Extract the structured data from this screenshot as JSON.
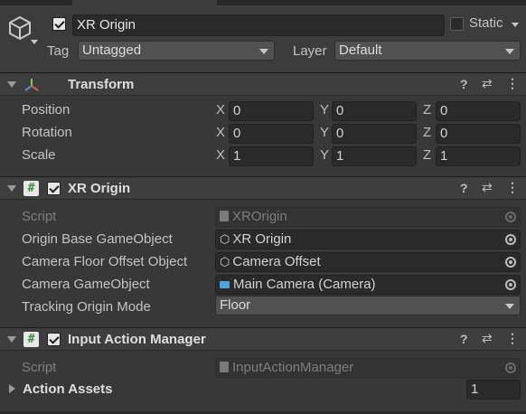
{
  "gameobject": {
    "name": "XR Origin",
    "active": true,
    "static_label": "Static",
    "static_checked": false,
    "tag_label": "Tag",
    "tag_value": "Untagged",
    "layer_label": "Layer",
    "layer_value": "Default"
  },
  "transform": {
    "title": "Transform",
    "rows": [
      {
        "label": "Position",
        "x": "0",
        "y": "0",
        "z": "0"
      },
      {
        "label": "Rotation",
        "x": "0",
        "y": "0",
        "z": "0"
      },
      {
        "label": "Scale",
        "x": "1",
        "y": "1",
        "z": "1"
      }
    ],
    "axis": {
      "x": "X",
      "y": "Y",
      "z": "Z"
    }
  },
  "xr_origin": {
    "title": "XR Origin",
    "enabled": true,
    "script_label": "Script",
    "script_value": "XROrigin",
    "origin_base_label": "Origin Base GameObject",
    "origin_base_value": "XR Origin",
    "camera_floor_label": "Camera Floor Offset Object",
    "camera_floor_value": "Camera Offset",
    "camera_go_label": "Camera GameObject",
    "camera_go_value": "Main Camera (Camera)",
    "tracking_label": "Tracking Origin Mode",
    "tracking_value": "Floor"
  },
  "input_action_manager": {
    "title": "Input Action Manager",
    "enabled": true,
    "script_label": "Script",
    "script_value": "InputActionManager",
    "action_assets_label": "Action Assets",
    "action_assets_count": "1"
  },
  "header_icons": {
    "help": "help-icon",
    "presets": "presets-icon",
    "menu": "kebab-menu-icon"
  },
  "script_icon_glyph": "#",
  "colors": {
    "background": "#383838",
    "header": "#3e3e3e",
    "field": "#2a2a2a",
    "camera_icon": "#4aa3df"
  }
}
